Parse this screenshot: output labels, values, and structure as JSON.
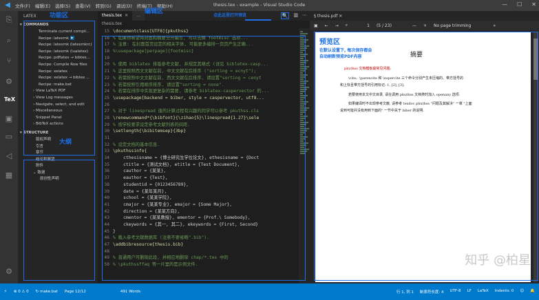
{
  "app": {
    "window_title": "thesis.tex - example - Visual Studio Code",
    "menu": [
      "文件(F)",
      "编辑(E)",
      "选择(S)",
      "查看(V)",
      "转到(G)",
      "调试(D)",
      "终端(T)",
      "帮助(H)"
    ]
  },
  "activity_icons": [
    "files-icon",
    "search-icon",
    "source-control-icon",
    "debug-icon",
    "tex-icon",
    "extensions-icon",
    "remote-icon",
    "live-share-icon",
    "accounts-icon",
    "settings-icon"
  ],
  "sidebar": {
    "title": "LATEX",
    "label_function": "功能区",
    "commands_header": "COMMANDS",
    "commands": [
      "Terminate current compil...",
      "Recipe: latexmk",
      "Recipe: latexmk (latexmkrc)",
      "Recipe: latexmk (lualatex)",
      "Recipe: pdflatex → bibtex...",
      "Recipe: Compile Row files",
      "Recipe: xelatex",
      "Recipe: xelatex → bibtex ...",
      "Recipe: make.bat",
      "View LaTeX PDF",
      "View Log messages",
      "Navigate, select, and edit",
      "Miscellaneous",
      "Snippet Panel",
      "BibTeX actions"
    ],
    "structure_header": "STRUCTURE",
    "label_outline": "大纲",
    "structure": [
      "版权声明",
      "引言",
      "章节",
      "结论和展望",
      "附件",
      "致谢",
      "原创性声明"
    ]
  },
  "editor": {
    "tabs": [
      "thesis.tex",
      "..."
    ],
    "label_edit": "编辑区",
    "label_preview_hint": "点此这里打开预览",
    "breadcrumb": "thesis.tex",
    "lines": [
      {
        "n": "15",
        "t": "\\documentclass[UTF8]{pkuthss}"
      },
      {
        "n": "16",
        "t": "% 如果你希望将封面和摘要分开编写, 可以去掉 footmisc 选项..."
      },
      {
        "n": "17",
        "t": "% 注意: 在封面首页设定的相关字体, 可能更多编排一页页产生正确..."
      },
      {
        "n": "18",
        "t": "%\\usepackage[perpage]{footmisc}"
      },
      {
        "n": "19",
        "t": ""
      },
      {
        "n": "20",
        "t": "% 使用 biblatex 排版参考文献, 并规定其格式 (详见 biblatex-casp..."
      },
      {
        "n": "21",
        "t": "% 这里按照西文文献在前, 中文文献在后排序 (\"sorting = ecnyt\");"
      },
      {
        "n": "22",
        "t": "% 若需按照中文文献在前, 西文文献在后排序, 请设置\"sorting = cenyt"
      },
      {
        "n": "23",
        "t": "% 若需按照引用顺序排序, 请设置\"sorting = none\"."
      },
      {
        "n": "24",
        "t": "% 若需在排序中实现更复杂的需要, 请参考 biblatex-caspervector 的..."
      },
      {
        "n": "25",
        "t": "\\usepackage[backend = biber, style = caspervector, utf8..."
      },
      {
        "n": "26",
        "t": ""
      },
      {
        "n": "27",
        "t": "% 对于 linespread 值的计算过程有兴趣的同学可以参考 pkuthss.cls"
      },
      {
        "n": "28",
        "t": "\\renewcommand*{\\bibfont}{\\zihao{5}\\linespread{1.27}\\sele"
      },
      {
        "n": "29",
        "t": "% 按学校要求设定参考文献列表的间距."
      },
      {
        "n": "30",
        "t": "\\setlength{\\bibitemsep}{3bp}"
      },
      {
        "n": "31",
        "t": ""
      },
      {
        "n": "32",
        "t": "% 设定文档的基本信息."
      },
      {
        "n": "33",
        "t": "\\pkuthssinfo{"
      },
      {
        "n": "34",
        "t": "    cthesisname = {博士研究生学位论文}, ethesisname = {Doct"
      },
      {
        "n": "35",
        "t": "    ctitle = {测试文档}, etitle = {Test Document},"
      },
      {
        "n": "36",
        "t": "    cauthor = {某某},"
      },
      {
        "n": "37",
        "t": "    eauthor = {Test},"
      },
      {
        "n": "38",
        "t": "    studentid = {0123456789},"
      },
      {
        "n": "39",
        "t": "    date = {某年某月},"
      },
      {
        "n": "40",
        "t": "    school = {某某学院},"
      },
      {
        "n": "41",
        "t": "    cmajor = {某某专业}, emajor = {Some Major},"
      },
      {
        "n": "42",
        "t": "    direction = {某某方向},"
      },
      {
        "n": "43",
        "t": "    cmentor = {某某教授}, ementor = {Prof.\\ Somebody},"
      },
      {
        "n": "44",
        "t": "    ckeywords = {其一, 其二}, ekeywords = {First, Second}"
      },
      {
        "n": "45",
        "t": "}"
      },
      {
        "n": "46",
        "t": "% 载入参考文献数据库 (注意不要省略\".bib\")."
      },
      {
        "n": "47",
        "t": "\\addbibresource{thesis.bib}"
      },
      {
        "n": "48",
        "t": ""
      },
      {
        "n": "49",
        "t": "% 普通用户可删除此段, 并相应地删除 chap/*.tex 中的"
      },
      {
        "n": "50",
        "t": "% \\pkuthssffaq 等一片里的是示例文件."
      }
    ]
  },
  "pdf": {
    "tab_label": "thesis.pdf",
    "toolbar": {
      "page": "1",
      "total": "(5 / 23)",
      "zoom": "No page trimming"
    },
    "label_preview": "预览区",
    "label_preview_sub1": "在默认设置下, 每次保存都会",
    "label_preview_sub2": "自动刷新预览PDF内容",
    "page_heading": "摘要",
    "page_lines": [
      "pkuthss 文档模板最常见问题:",
      "\\cite、\\parencite 和 \\supercite 三个命令分别产生未压缩的、带方括号的",
      "和上标且带方括号的引用标记: 1, [2], [3].",
      "若要使用本文中文目录, 请在调用 pkuthss 文档类时加入 openany 选项.",
      "如果编译时不出现参考文献, 请参考 texdoc pkuthss \"问题及其解决\" 一章 \"上面",
      "说到可能并没有用到下面的\" 一节中关于 biber 的说明."
    ],
    "watermark": "知乎 @柏星"
  },
  "status": {
    "left": [
      "⊗ 0 ⚠ 0",
      "make.bat",
      "Page 12/12",
      "491 Words"
    ],
    "right": [
      "行 1, 列 1",
      "制表符长度: 4",
      "UTF-8",
      "LF",
      "LaTeX",
      "Indents: 0"
    ]
  },
  "colors": {
    "accent": "#007acc",
    "label": "#1a6fe6",
    "pdf_red": "#c00000"
  }
}
